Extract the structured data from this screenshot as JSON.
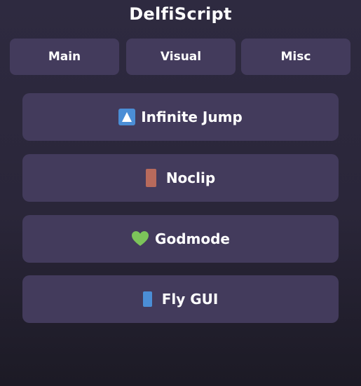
{
  "app": {
    "title": "DelfiScript"
  },
  "tabs": [
    {
      "label": "Main"
    },
    {
      "label": "Visual"
    },
    {
      "label": "Misc"
    }
  ],
  "buttons": [
    {
      "label": "Infinite Jump",
      "icon": "up-arrow-icon",
      "icon_color": "#4b8ed6"
    },
    {
      "label": "Noclip",
      "icon": "door-icon",
      "icon_color": "#b86a5c"
    },
    {
      "label": "Godmode",
      "icon": "green-heart-icon",
      "icon_color": "#7cc45a"
    },
    {
      "label": "Fly GUI",
      "icon": "blue-book-icon",
      "icon_color": "#4b8ed6"
    }
  ],
  "colors": {
    "background": "#2e2a40",
    "panel": "#433b5c",
    "text": "#ffffff"
  }
}
